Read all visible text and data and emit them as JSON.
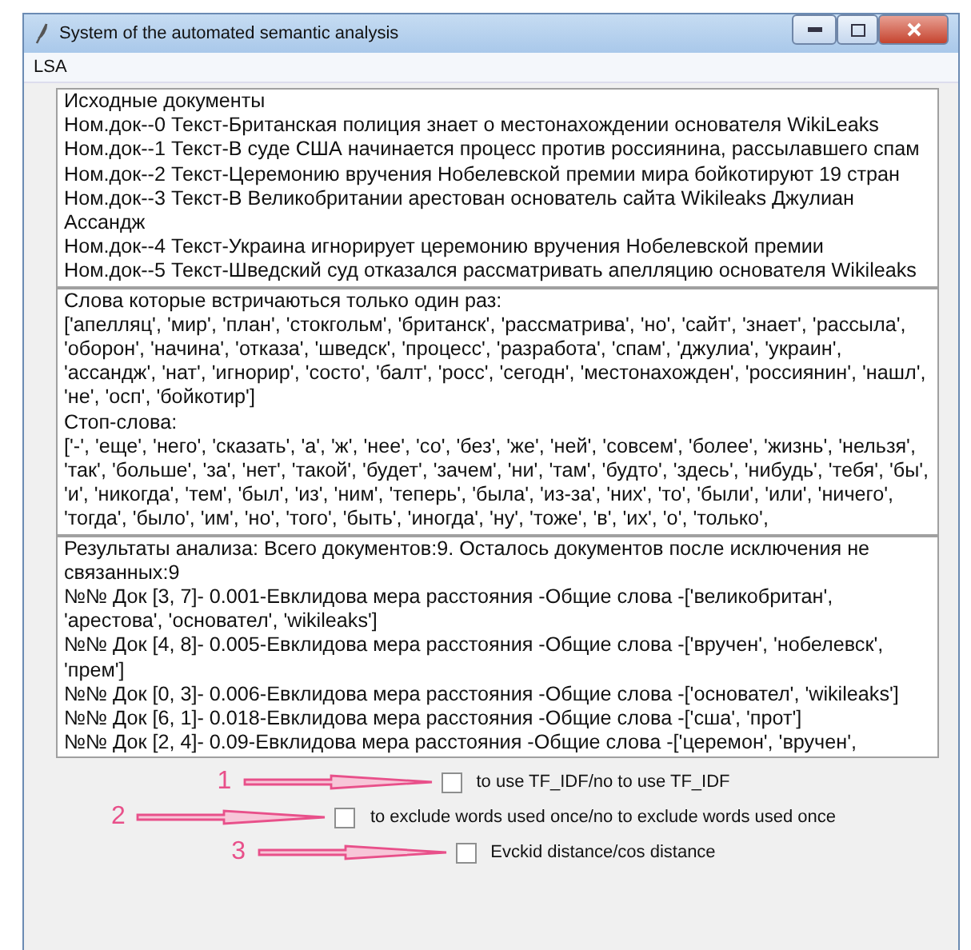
{
  "window": {
    "title": "System of the automated semantic analysis"
  },
  "menu": [
    {
      "label": "LSA"
    }
  ],
  "panels": [
    {
      "lines": [
        "Исходные документы",
        "Ном.док--0 Текст-Британская полиция знает о местонахождении основателя WikiLeaks",
        "Ном.док--1 Текст-В суде США начинается процесс против россиянина, рассылавшего спам",
        "Ном.док--2 Текст-Церемонию вручения Нобелевской премии мира бойкотируют 19 стран",
        "Ном.док--3 Текст-В Великобритании арестован основатель сайта Wikileaks Джулиан Ассандж",
        "Ном.док--4 Текст-Украина игнорирует церемонию вручения Нобелевской премии",
        "Ном.док--5 Текст-Шведский суд отказался рассматривать апелляцию основателя Wikileaks"
      ]
    },
    {
      "lines": [
        "Слова которые встричаються только один раз:",
        "['апелляц', 'мир', 'план', 'стокгольм', 'британск', 'рассматрива', 'но', 'сайт', 'знает', 'рассыла', 'оборон', 'начина', 'отказа', 'шведск', 'процесс', 'разработа', 'спам', 'джулиа', 'украин', 'ассандж', 'нат', 'игнорир', 'состо', 'балт', 'росс', 'сегодн', 'местонахожден', 'россиянин', 'нашл', 'не', 'осп', 'бойкотир']",
        "Стоп-слова:",
        "['-', 'еще', 'него', 'сказать', 'а', 'ж', 'нее', 'со', 'без', 'же', 'ней', 'совсем', 'более', 'жизнь', 'нельзя', 'так', 'больше', 'за', 'нет', 'такой', 'будет', 'зачем', 'ни', 'там', 'будто', 'здесь', 'нибудь', 'тебя', 'бы', 'и', 'никогда', 'тем', 'был', 'из', 'ним', 'теперь', 'была', 'из-за', 'них', 'то', 'были', 'или', 'ничего', 'тогда', 'было', 'им', 'но', 'того', 'быть', 'иногда', 'ну', 'тоже', 'в', 'их', 'о', 'только',"
      ]
    },
    {
      "lines": [
        "Результаты анализа: Всего документов:9. Осталось документов после исключения не связанных:9",
        "№№ Док [3, 7]- 0.001-Евклидова мера расстояния  -Общие слова -['великобритан', 'арестова', 'основател', 'wikileaks']",
        "№№ Док [4, 8]- 0.005-Евклидова мера расстояния  -Общие слова -['вручен', 'нобелевск', 'прем']",
        "№№ Док [0, 3]- 0.006-Евклидова мера расстояния  -Общие слова -['основател', 'wikileaks']",
        "№№ Док [6, 1]- 0.018-Евклидова мера расстояния  -Общие слова -['сша', 'прот']",
        "№№ Док [2, 4]- 0.09-Евклидова мера расстояния  -Общие слова -['церемон', 'вручен',"
      ]
    }
  ],
  "options": [
    {
      "number": "1",
      "label": "to use TF_IDF/no to use TF_IDF",
      "checked": false
    },
    {
      "number": "2",
      "label": "to exclude words used once/no to exclude words used once",
      "checked": false
    },
    {
      "number": "3",
      "label": "Evckid distance/cos distance",
      "checked": false
    }
  ]
}
